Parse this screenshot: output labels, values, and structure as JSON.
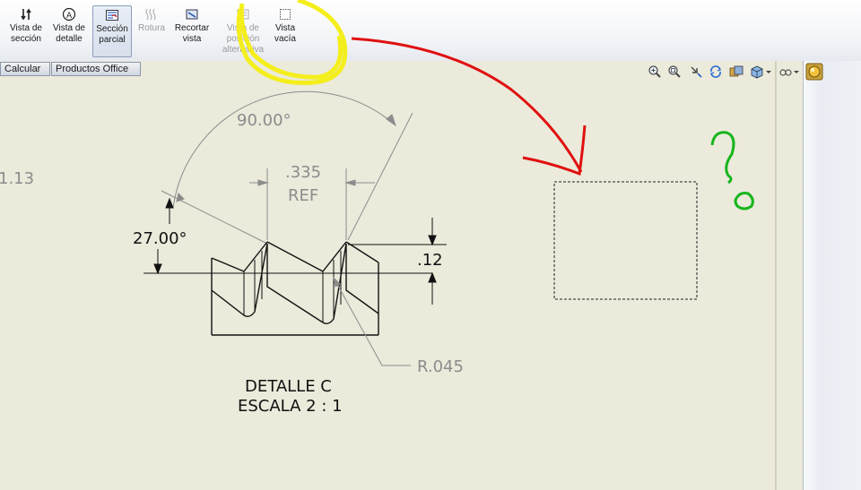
{
  "ribbon": {
    "buttons": [
      {
        "line1": "Vista de",
        "line2": "sección",
        "state": "normal",
        "icon": "section-view-icon"
      },
      {
        "line1": "Vista de",
        "line2": "detalle",
        "state": "normal",
        "icon": "detail-view-icon"
      },
      {
        "line1": "Sección",
        "line2": "parcial",
        "state": "active",
        "icon": "broken-out-section-icon"
      },
      {
        "line1": "Rotura",
        "line2": "",
        "state": "disabled",
        "icon": "break-icon"
      },
      {
        "line1": "Recortar",
        "line2": "vista",
        "state": "normal",
        "icon": "crop-view-icon"
      },
      {
        "line1": "Vista de",
        "line2": "posición",
        "line3": "alternativa",
        "state": "disabled",
        "icon": "alternate-position-icon"
      },
      {
        "line1": "Vista",
        "line2": "vacía",
        "state": "normal",
        "icon": "empty-view-icon"
      }
    ]
  },
  "tabs": [
    "Calcular",
    "Productos Office"
  ],
  "heads_up_icons": [
    "zoom-to-fit-icon",
    "zoom-area-icon",
    "previous-view-icon",
    "rebuild-icon",
    "view-settings-icon",
    "display-style-icon",
    "hide-show-icon",
    "appearance-icon"
  ],
  "drawing": {
    "partial_dim": "1.13",
    "angle_top": "90.00°",
    "ref_value": ".335",
    "ref_label": "REF",
    "angle_left": "27.00°",
    "height_dim": ".12",
    "radius_dim": "R.045",
    "detail_title": "DETALLE C",
    "detail_scale": "ESCALA 2 : 1"
  },
  "colors": {
    "annotation_yellow": "#f4ee1c",
    "annotation_red": "#e01010",
    "annotation_green": "#17b51c",
    "dimension_gray": "#8c8c8c",
    "sheet_bg": "#ebeadb"
  }
}
